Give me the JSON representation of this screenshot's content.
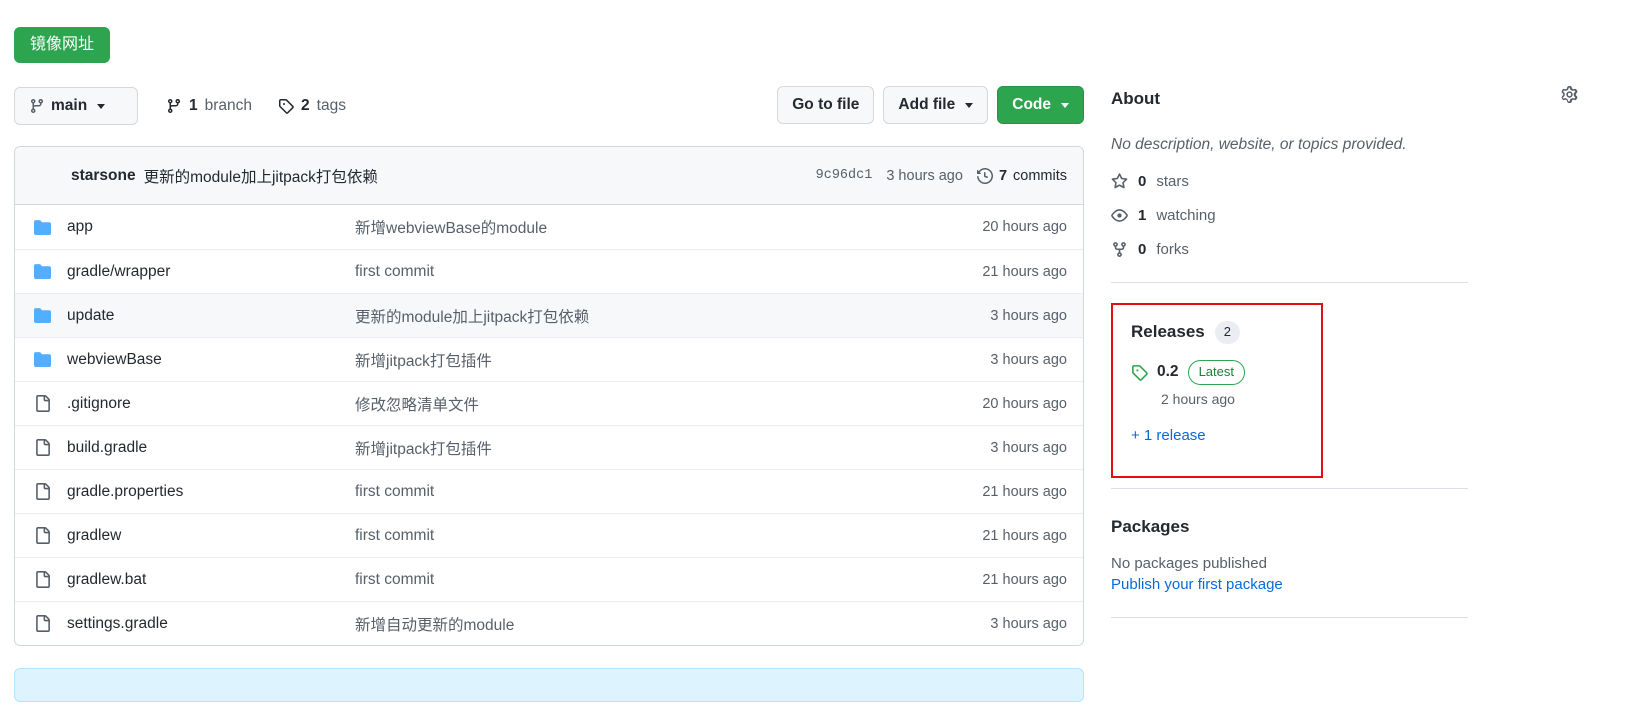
{
  "mirror_badge": {
    "label": "镜像网址"
  },
  "toolbar": {
    "branch_name": "main",
    "branch_count": "1",
    "branch_label": "branch",
    "tag_count": "2",
    "tag_label": "tags",
    "go_to_file": "Go to file",
    "add_file": "Add file",
    "code": "Code"
  },
  "commit_header": {
    "author": "starsone",
    "message": "更新的module加上jitpack打包依赖",
    "sha": "9c96dc1",
    "date": "3 hours ago",
    "commits_count": "7",
    "commits_label": "commits"
  },
  "files": [
    {
      "type": "dir",
      "name": "app",
      "message": "新增webviewBase的module",
      "time": "20 hours ago",
      "highlighted": false
    },
    {
      "type": "dir",
      "name": "gradle/wrapper",
      "message": "first commit",
      "time": "21 hours ago",
      "highlighted": false
    },
    {
      "type": "dir",
      "name": "update",
      "message": "更新的module加上jitpack打包依赖",
      "time": "3 hours ago",
      "highlighted": true
    },
    {
      "type": "dir",
      "name": "webviewBase",
      "message": "新增jitpack打包插件",
      "time": "3 hours ago",
      "highlighted": false
    },
    {
      "type": "file",
      "name": ".gitignore",
      "message": "修改忽略清单文件",
      "time": "20 hours ago",
      "highlighted": false
    },
    {
      "type": "file",
      "name": "build.gradle",
      "message": "新增jitpack打包插件",
      "time": "3 hours ago",
      "highlighted": false
    },
    {
      "type": "file",
      "name": "gradle.properties",
      "message": "first commit",
      "time": "21 hours ago",
      "highlighted": false
    },
    {
      "type": "file",
      "name": "gradlew",
      "message": "first commit",
      "time": "21 hours ago",
      "highlighted": false
    },
    {
      "type": "file",
      "name": "gradlew.bat",
      "message": "first commit",
      "time": "21 hours ago",
      "highlighted": false
    },
    {
      "type": "file",
      "name": "settings.gradle",
      "message": "新增自动更新的module",
      "time": "3 hours ago",
      "highlighted": false
    }
  ],
  "about": {
    "title": "About",
    "description": "No description, website, or topics provided.",
    "stars_count": "0",
    "stars_label": "stars",
    "watching_count": "1",
    "watching_label": "watching",
    "forks_count": "0",
    "forks_label": "forks"
  },
  "releases": {
    "title": "Releases",
    "count": "2",
    "version": "0.2",
    "latest_badge": "Latest",
    "date": "2 hours ago",
    "more_link": "+ 1 release",
    "highlight_color": "#e40f0f"
  },
  "packages": {
    "title": "Packages",
    "empty_text": "No packages published",
    "publish_link": "Publish your first package"
  },
  "colors": {
    "green": "#2da44e",
    "link_blue": "#0969da",
    "folder_blue": "#54aeff",
    "muted": "#57606a"
  }
}
